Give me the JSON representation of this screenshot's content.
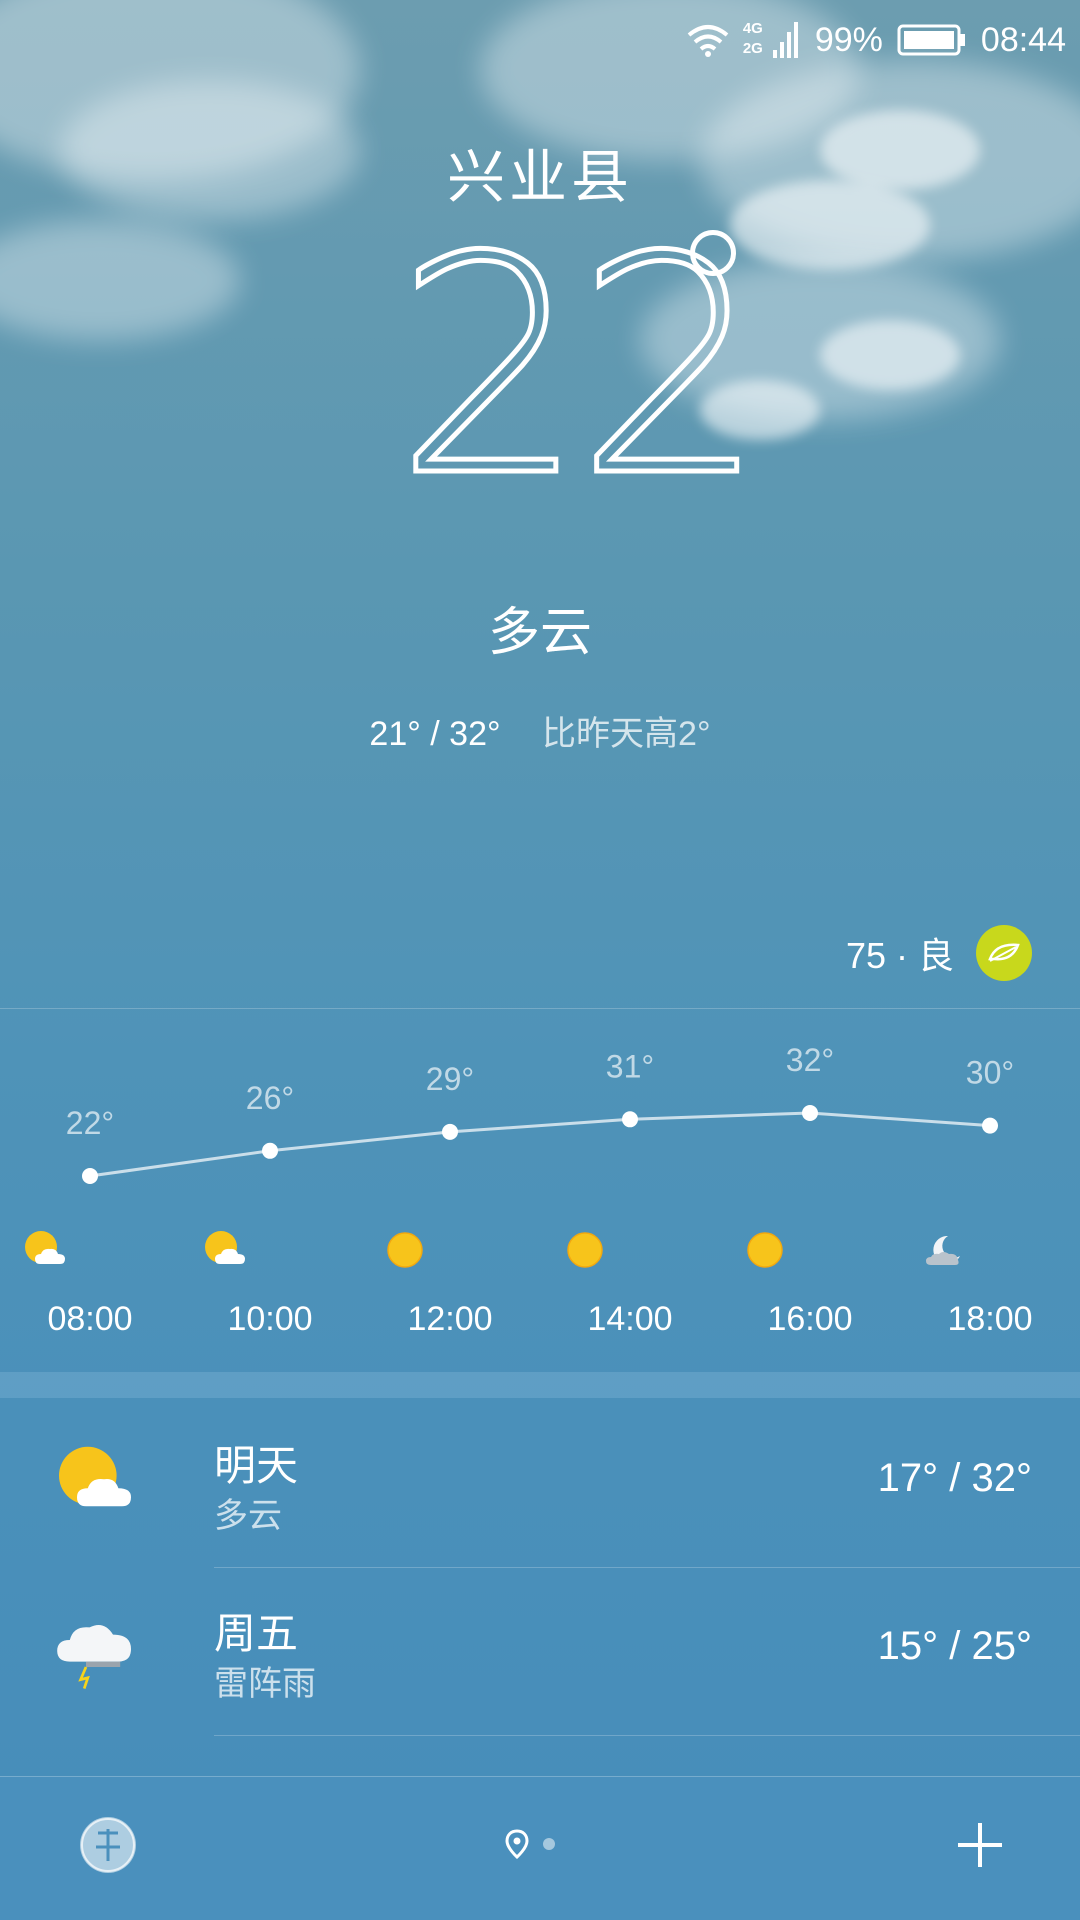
{
  "status_bar": {
    "network_top": "4G",
    "network_bottom": "2G",
    "battery": "99%",
    "time": "08:44"
  },
  "location": {
    "city": "兴业县"
  },
  "current": {
    "temperature": "22",
    "condition": "多云",
    "range": "21° / 32°",
    "compare": "比昨天高2°"
  },
  "aqi": {
    "text": "75 · 良",
    "color": "#c8d81c"
  },
  "hourly": [
    {
      "time": "08:00",
      "temp_label": "22°",
      "temp": 22,
      "icon": "partly-cloudy-icon"
    },
    {
      "time": "10:00",
      "temp_label": "26°",
      "temp": 26,
      "icon": "partly-cloudy-icon"
    },
    {
      "time": "12:00",
      "temp_label": "29°",
      "temp": 29,
      "icon": "sun-icon"
    },
    {
      "time": "14:00",
      "temp_label": "31°",
      "temp": 31,
      "icon": "sun-icon"
    },
    {
      "time": "16:00",
      "temp_label": "32°",
      "temp": 32,
      "icon": "sun-icon"
    },
    {
      "time": "18:00",
      "temp_label": "30°",
      "temp": 30,
      "icon": "moon-cloud-icon"
    }
  ],
  "daily": [
    {
      "day": "明天",
      "condition": "多云",
      "range": "17° / 32°",
      "icon": "partly-cloudy-icon"
    },
    {
      "day": "周五",
      "condition": "雷阵雨",
      "range": "15° / 25°",
      "icon": "thunderstorm-icon"
    }
  ],
  "colors": {
    "sun": "#f7c41b",
    "accent_bg": "#4a90bd"
  }
}
